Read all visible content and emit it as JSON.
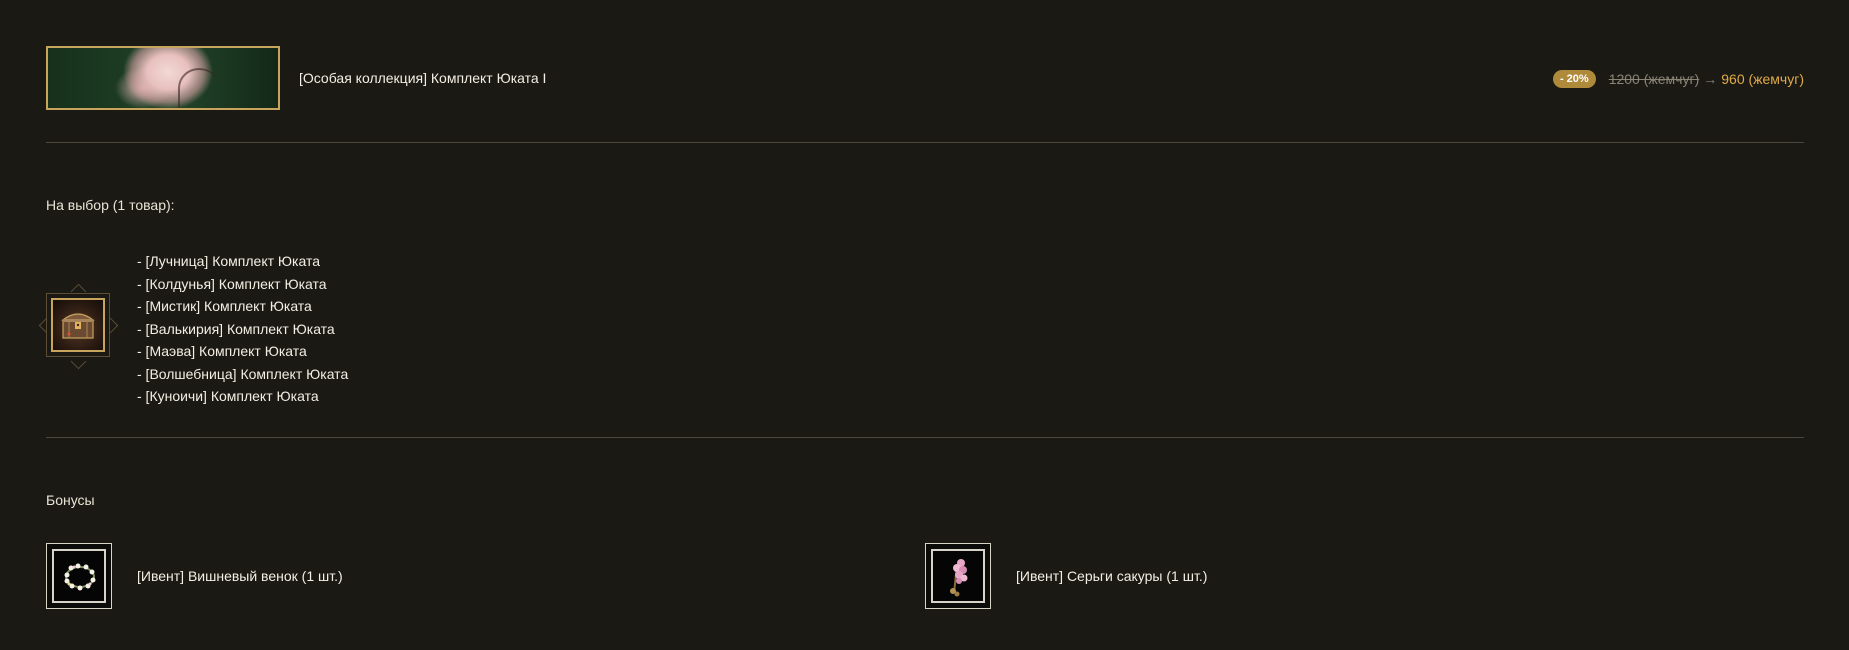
{
  "product": {
    "title": "[Особая коллекция] Комплект Юката I",
    "discount_badge": "- 20%",
    "old_price": "1200 (жемчуг)",
    "arrow": "→",
    "new_price": "960 (жемчуг)"
  },
  "choice": {
    "label": "На выбор (1 товар):",
    "icon": "chest-icon",
    "items": [
      "- [Лучница] Комплект Юката",
      "- [Колдунья] Комплект Юката",
      "- [Мистик] Комплект Юката",
      "- [Валькирия] Комплект Юката",
      "- [Маэва] Комплект Юката",
      "- [Волшебница] Комплект Юката",
      "- [Куноичи] Комплект Юката"
    ]
  },
  "bonuses": {
    "label": "Бонусы",
    "items": [
      {
        "label": "[Ивент] Вишневый венок (1 шт.)",
        "icon": "flower-wreath-icon"
      },
      {
        "label": "[Ивент] Серьги сакуры (1 шт.)",
        "icon": "sakura-earrings-icon"
      }
    ]
  },
  "colors": {
    "background": "#1a1913",
    "accent_gold": "#c9a45c",
    "badge": "#b08a3b",
    "new_price": "#e0a94b",
    "divider": "#4a473d"
  }
}
